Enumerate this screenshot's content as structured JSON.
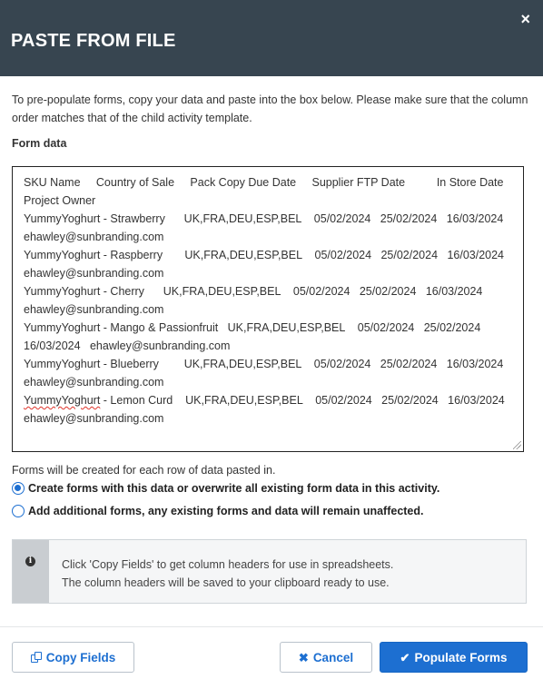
{
  "dialog": {
    "title": "PASTE FROM FILE",
    "close_glyph": "×"
  },
  "intro": "To pre-populate forms, copy your data and paste into the box below. Please make sure that the column order matches that of the child activity template.",
  "form_label": "Form data",
  "textarea": {
    "header_line1": "SKU Name     Country of Sale     Pack Copy Due Date     Supplier FTP Date          In Store Date",
    "header_line2": "Project Owner",
    "rows": [
      {
        "line1": "YummyYoghurt - Strawberry      UK,FRA,DEU,ESP,BEL    05/02/2024   25/02/2024   16/03/2024",
        "line2": "ehawley@sunbranding.com"
      },
      {
        "line1": "YummyYoghurt - Raspberry       UK,FRA,DEU,ESP,BEL    05/02/2024   25/02/2024   16/03/2024",
        "line2": "ehawley@sunbranding.com"
      },
      {
        "line1": "YummyYoghurt - Cherry      UK,FRA,DEU,ESP,BEL    05/02/2024   25/02/2024   16/03/2024",
        "line2": "ehawley@sunbranding.com"
      },
      {
        "line1": "YummyYoghurt - Mango & Passionfruit   UK,FRA,DEU,ESP,BEL    05/02/2024   25/02/2024",
        "line2": "16/03/2024   ehawley@sunbranding.com"
      },
      {
        "line1": "YummyYoghurt - Blueberry        UK,FRA,DEU,ESP,BEL    05/02/2024   25/02/2024   16/03/2024",
        "line2": "ehawley@sunbranding.com"
      }
    ],
    "last_row_word": "YummyYoghurt",
    "last_row_rest": " - Lemon Curd    UK,FRA,DEU,ESP,BEL    05/02/2024   25/02/2024   16/03/2024",
    "last_row_line2": "ehawley@sunbranding.com"
  },
  "forms_note": "Forms will be created for each row of data pasted in.",
  "options": {
    "overwrite": "Create forms with this data or overwrite all existing form data in this activity.",
    "add": "Add additional forms, any existing forms and data will remain unaffected.",
    "selected": "overwrite"
  },
  "info": {
    "icon": "info-icon",
    "line1": "Click 'Copy Fields' to get column headers for use in spreadsheets.",
    "line2": "The column headers will be saved to your clipboard ready to use."
  },
  "buttons": {
    "copy_fields": "Copy Fields",
    "cancel": "Cancel",
    "populate": "Populate Forms"
  },
  "colors": {
    "header_bg": "#374550",
    "accent": "#1d6fd1"
  }
}
